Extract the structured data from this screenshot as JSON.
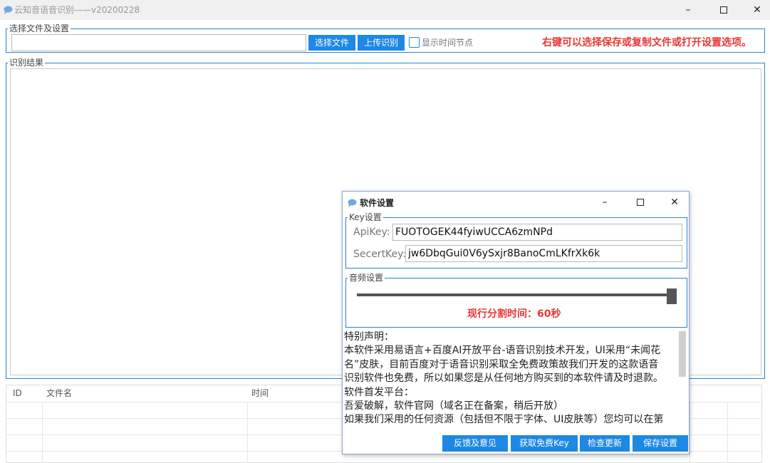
{
  "window": {
    "title": "云知音语音识别——v20200228",
    "controls": {
      "minimize": "–",
      "maximize": "",
      "close": "✕"
    },
    "icon": "chat-bubble-icon"
  },
  "file_group": {
    "legend": "选择文件及设置",
    "file_path": "",
    "select_button": "选择文件",
    "upload_button": "上传识别",
    "show_time_label": "显示时间节点",
    "show_time_checked": false,
    "hint": "右键可以选择保存或复制文件或打开设置选项。"
  },
  "result_group": {
    "legend": "识别结果",
    "text": ""
  },
  "table": {
    "columns": [
      "ID",
      "文件名",
      "时间"
    ],
    "rows": []
  },
  "dialog": {
    "title": "软件设置",
    "controls": {
      "minimize": "–",
      "maximize": "",
      "close": "✕"
    },
    "key_group": {
      "legend": "Key设置",
      "api_key_label": "ApiKey:",
      "api_key_value": "FUOTOGEK44fyiwUCCA6zmNPd",
      "secret_key_label": "SecertKey:",
      "secret_key_value": "jw6DbqGui0V6ySxjr8BanoCmLKfrXk6k"
    },
    "audio_group": {
      "legend": "音频设置",
      "segment_seconds": 60,
      "segment_max_seconds": 60,
      "segment_label": "现行分割时间：60秒"
    },
    "notice_lines": [
      "特别声明：",
      "本软件采用易语言+百度AI开放平台-语音识别技术开发，UI采用“未闻花",
      "名”皮肤，目前百度对于语音识别采取全免费政策故我们开发的这款语音",
      "识别软件也免费，所以如果您是从任何地方购买到的本软件请及时退款。",
      "软件首发平台：",
      "吾爱破解，软件官网（域名正在备案，稍后开放）",
      "如果我们采用的任何资源（包括但不限于字体、UI皮肤等）您均可以在第"
    ],
    "buttons": {
      "feedback": "反馈及意见",
      "free_key": "获取免费Key",
      "check_update": "检查更新",
      "save": "保存设置"
    }
  }
}
